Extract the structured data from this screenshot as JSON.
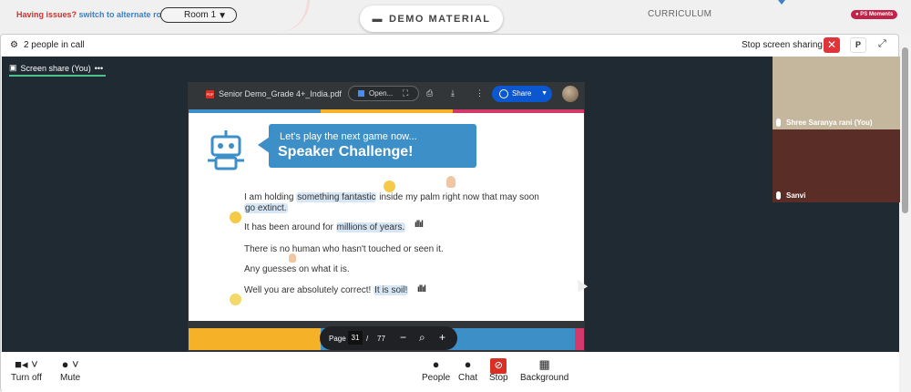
{
  "topbar": {
    "issue_q": "Having issues?",
    "issue_link": "switch to alternate room",
    "room_select": "Room 1",
    "demo_material": "DEMO MATERIAL",
    "curriculum": "CURRICULUM",
    "moments": "PS Moments"
  },
  "call": {
    "people_count": "2 people in call",
    "stop_sharing": "Stop screen sharing",
    "p_button": "P"
  },
  "stage": {
    "share_tab": "Screen share (You)",
    "share_tab_more": "•••"
  },
  "pdf": {
    "filename": "Senior Demo_Grade 4+_India.pdf",
    "open_button": "Open...",
    "share_button": "Share",
    "page_label": "Page",
    "current_page": "31",
    "page_sep": "/",
    "total_pages": "77"
  },
  "slide": {
    "bubble_line1": "Let's play the next game now...",
    "bubble_line2": "Speaker Challenge!",
    "lines": [
      {
        "pre": "I am holding ",
        "hl": "something fantastic",
        "post": " inside my palm right now that may soon"
      },
      {
        "hl": "go extinct."
      },
      {
        "pre": "It has been around for ",
        "hl": "millions of years."
      },
      {
        "text": "There is no human who hasn't touched or seen it."
      },
      {
        "text": "Any guesses on what it is."
      },
      {
        "pre": "Well you are absolutely correct! ",
        "hl": "It is soil!"
      }
    ]
  },
  "participants": [
    {
      "name": "Shree Saranya rani (You)"
    },
    {
      "name": "Sanvi"
    }
  ],
  "controls": {
    "turn_off": "Turn off",
    "mute": "Mute",
    "people": "People",
    "chat": "Chat",
    "stop": "Stop",
    "background": "Background"
  }
}
